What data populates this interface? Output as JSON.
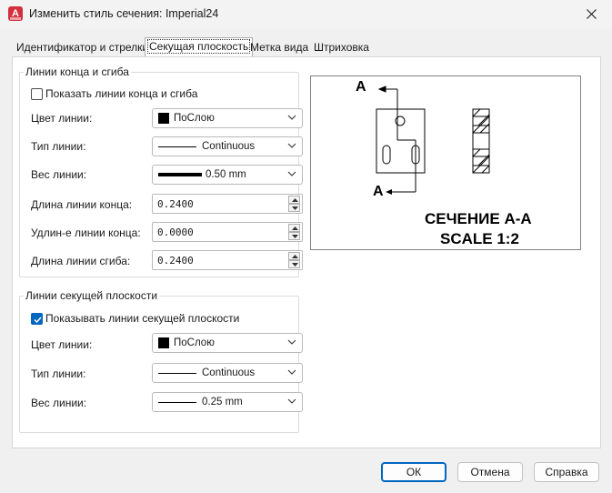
{
  "window": {
    "title": "Изменить стиль сечения: Imperial24",
    "app_icon_letter": "A",
    "icon": "close-icon"
  },
  "tabs": [
    {
      "label": "Идентификатор и стрелки"
    },
    {
      "label": "Секущая плоскость",
      "active": true
    },
    {
      "label": "Метка вида"
    },
    {
      "label": "Штриховка"
    }
  ],
  "end_lines": {
    "title": "Линии конца и сгиба",
    "show_label": "Показать линии конца и сгиба",
    "show_checked": false,
    "color_label": "Цвет линии:",
    "color_value": "ПоСлою",
    "type_label": "Тип линии:",
    "type_value": "Continuous",
    "weight_label": "Вес линии:",
    "weight_value": "0.50 mm",
    "end_length_label": "Длина линии конца:",
    "end_length_value": "0.2400",
    "extension_label": "Удлин-е линии конца:",
    "extension_value": "0.0000",
    "bend_length_label": "Длина линии сгиба:",
    "bend_length_value": "0.2400"
  },
  "cut_lines": {
    "title": "Линии секущей плоскости",
    "show_label": "Показывать линии секущей плоскости",
    "show_checked": true,
    "color_label": "Цвет линии:",
    "color_value": "ПоСлою",
    "type_label": "Тип линии:",
    "type_value": "Continuous",
    "weight_label": "Вес линии:",
    "weight_value": "0.25 mm"
  },
  "preview": {
    "marker_top": "A",
    "marker_bottom": "A",
    "caption_line1": "СЕЧЕНИЕ А-А",
    "caption_line2": "SCALE 1:2"
  },
  "buttons": {
    "ok": "ОК",
    "cancel": "Отмена",
    "help": "Справка"
  },
  "colors": {
    "accent": "#0067c0",
    "app_icon": "#d32f3c"
  }
}
